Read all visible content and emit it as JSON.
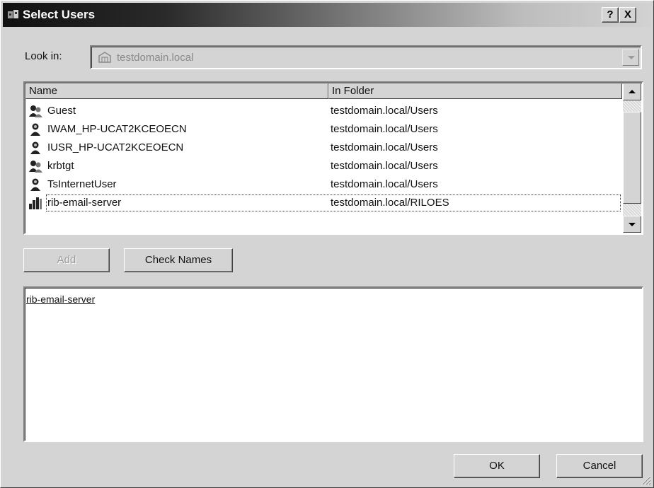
{
  "window": {
    "title": "Select Users",
    "help_label": "?",
    "close_label": "X"
  },
  "look_in": {
    "label": "Look in:",
    "value": "testdomain.local"
  },
  "list": {
    "columns": [
      "Name",
      "In Folder"
    ],
    "rows": [
      {
        "name": "Guest",
        "folder": "testdomain.local/Users",
        "icon": "user-group-icon"
      },
      {
        "name": "IWAM_HP-UCAT2KCEOECN",
        "folder": "testdomain.local/Users",
        "icon": "user-icon"
      },
      {
        "name": "IUSR_HP-UCAT2KCEOECN",
        "folder": "testdomain.local/Users",
        "icon": "user-icon"
      },
      {
        "name": "krbtgt",
        "folder": "testdomain.local/Users",
        "icon": "user-group-icon"
      },
      {
        "name": "TsInternetUser",
        "folder": "testdomain.local/Users",
        "icon": "user-icon"
      },
      {
        "name": "rib-email-server",
        "folder": "testdomain.local/RILOES",
        "icon": "server-icon"
      }
    ]
  },
  "buttons": {
    "add": "Add",
    "check_names": "Check Names",
    "ok": "OK",
    "cancel": "Cancel"
  },
  "selected_names": "rib-email-server"
}
